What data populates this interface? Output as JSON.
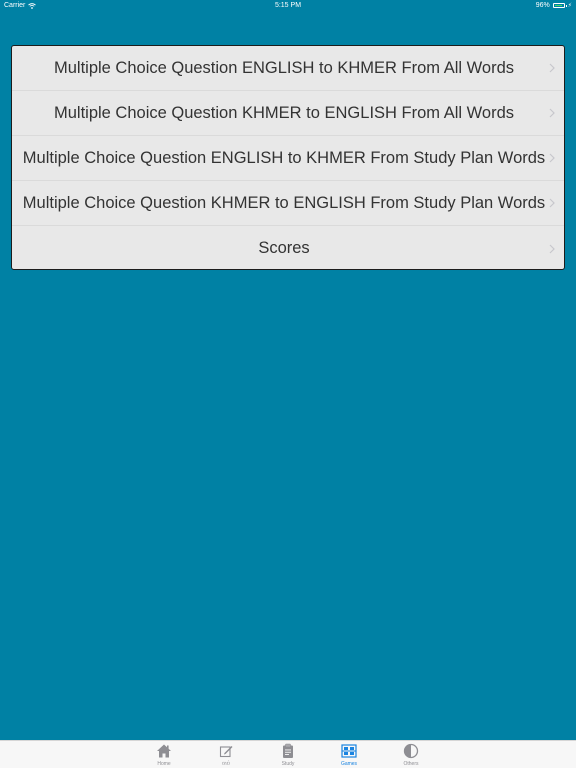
{
  "status_bar": {
    "carrier": "Carrier",
    "time": "5:15 PM",
    "battery_percent_text": "96%",
    "battery_level": 0.96
  },
  "menu": {
    "items": [
      {
        "label": "Multiple Choice Question ENGLISH to KHMER From All Words"
      },
      {
        "label": "Multiple Choice Question KHMER to ENGLISH From All Words"
      },
      {
        "label": "Multiple Choice Question ENGLISH to KHMER From Study Plan Words"
      },
      {
        "label": "Multiple Choice Question KHMER to ENGLISH From Study Plan Words"
      },
      {
        "label": "Scores"
      }
    ]
  },
  "tab_bar": {
    "active_tab": "Games",
    "tabs": [
      {
        "label": "Home",
        "icon": "home-icon"
      },
      {
        "label": "ចាប់",
        "icon": "edit-icon"
      },
      {
        "label": "Study",
        "icon": "clipboard-icon"
      },
      {
        "label": "Games",
        "icon": "games-icon"
      },
      {
        "label": "Others",
        "icon": "contrast-icon"
      }
    ]
  },
  "colors": {
    "background": "#0081a4",
    "cell_background": "#e8e8e8",
    "tab_active": "#1a84e0",
    "tab_inactive": "#8e8e93",
    "battery_fill": "#4cd964"
  }
}
